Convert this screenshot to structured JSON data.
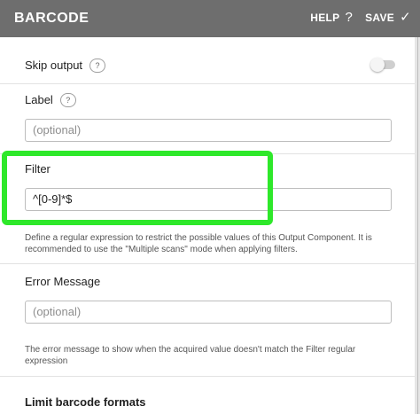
{
  "header": {
    "title": "BARCODE",
    "help_label": "HELP",
    "help_icon": "?",
    "save_label": "SAVE",
    "save_icon": "✓",
    "background": "#6e6e6e"
  },
  "skip_output": {
    "label": "Skip output",
    "help": "?",
    "enabled": false
  },
  "label_field": {
    "label": "Label",
    "help": "?",
    "placeholder": "(optional)",
    "value": ""
  },
  "filter_field": {
    "label": "Filter",
    "value": "^[0-9]*$",
    "help_text": "Define a regular expression to restrict the possible values of this Output Component. It is recommended to use the \"Multiple scans\" mode when applying filters.",
    "highlight_color": "#2ee82a"
  },
  "error_message_field": {
    "label": "Error Message",
    "placeholder": "(optional)",
    "value": "",
    "help_text": "The error message to show when the acquired value doesn't match the Filter regular expression"
  },
  "limit_barcode_formats": {
    "label": "Limit barcode formats"
  }
}
